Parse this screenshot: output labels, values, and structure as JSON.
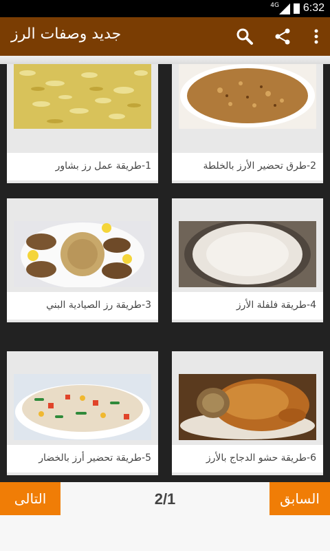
{
  "status_bar": {
    "network": "4G",
    "time": "6:32"
  },
  "app_bar": {
    "title": "جديد وصفات الرز",
    "icons": [
      "search-icon",
      "share-icon",
      "overflow-menu-icon"
    ]
  },
  "recipes": [
    {
      "label": "1-طريقة عمل رز بشاور",
      "image": "yellow-rice-photo"
    },
    {
      "label": "2-طرق تحضير الأرز بالخلطة",
      "image": "mixed-rice-photo"
    },
    {
      "label": "3-طريقة رز الصيادية البني",
      "image": "fish-rice-photo"
    },
    {
      "label": "4-طريقة فلفلة الأرز",
      "image": "plain-rice-pot-photo"
    },
    {
      "label": "5-طريقة تحضير أرز بالخضار",
      "image": "vegetable-rice-photo"
    },
    {
      "label": "6-طريقة حشو الدجاج بالأرز",
      "image": "stuffed-chicken-photo"
    }
  ],
  "pagination": {
    "next_label": "التالى",
    "prev_label": "السابق",
    "page_indicator": "2/1"
  },
  "colors": {
    "app_bar": "#7a3d03",
    "button": "#f07d06",
    "background": "#222222"
  }
}
